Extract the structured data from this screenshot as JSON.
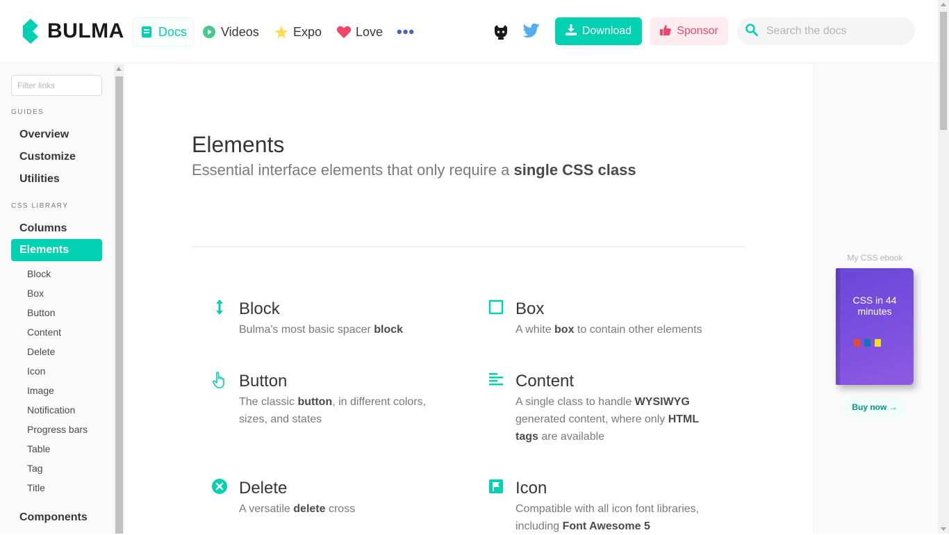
{
  "brand": {
    "name": "BULMA",
    "color": "#00d1b2"
  },
  "nav": {
    "items": [
      {
        "label": "Docs",
        "icon": "book-icon"
      },
      {
        "label": "Videos",
        "icon": "play-circle-icon"
      },
      {
        "label": "Expo",
        "icon": "star-icon"
      },
      {
        "label": "Love",
        "icon": "heart-icon"
      }
    ],
    "more_label": "•••",
    "download_label": "Download",
    "sponsor_label": "Sponsor",
    "search_placeholder": "Search the docs"
  },
  "sidebar": {
    "filter_placeholder": "Filter links",
    "guides_label": "GUIDES",
    "guides": [
      "Overview",
      "Customize",
      "Utilities"
    ],
    "library_label": "CSS LIBRARY",
    "library": [
      "Columns",
      "Elements"
    ],
    "active": "Elements",
    "sub_items": [
      "Block",
      "Box",
      "Button",
      "Content",
      "Delete",
      "Icon",
      "Image",
      "Notification",
      "Progress bars",
      "Table",
      "Tag",
      "Title"
    ],
    "next_section": "Components"
  },
  "hero": {
    "title": "Elements",
    "subtitle_plain": "Essential interface elements that only require a ",
    "subtitle_bold": "single CSS class"
  },
  "elements": [
    {
      "title": "Block",
      "icon": "arrows-vertical-icon",
      "desc": [
        "Bulma's most basic spacer ",
        "block",
        ""
      ]
    },
    {
      "title": "Box",
      "icon": "square-outline-icon",
      "desc": [
        "A white ",
        "box",
        " to contain other elements"
      ]
    },
    {
      "title": "Button",
      "icon": "hand-pointer-icon",
      "desc": [
        "The classic ",
        "button",
        ", in different colors, sizes, and states"
      ]
    },
    {
      "title": "Content",
      "icon": "align-left-icon",
      "desc": [
        "A single class to handle ",
        "WYSIWYG",
        " generated content, where only ",
        "HTML tags",
        " are available"
      ]
    },
    {
      "title": "Delete",
      "icon": "times-circle-icon",
      "desc": [
        "A versatile ",
        "delete",
        " cross"
      ]
    },
    {
      "title": "Icon",
      "icon": "flag-icon",
      "desc": [
        "Compatible with all icon font libraries, including ",
        "Font Awesome 5",
        ""
      ]
    }
  ],
  "aside": {
    "ebook_label": "My CSS ebook",
    "ebook_title": "CSS in 44 minutes",
    "buy_label": "Buy now →"
  },
  "colors": {
    "primary": "#00d1b2",
    "sponsor": "#f14668",
    "link": "#485fc7"
  }
}
